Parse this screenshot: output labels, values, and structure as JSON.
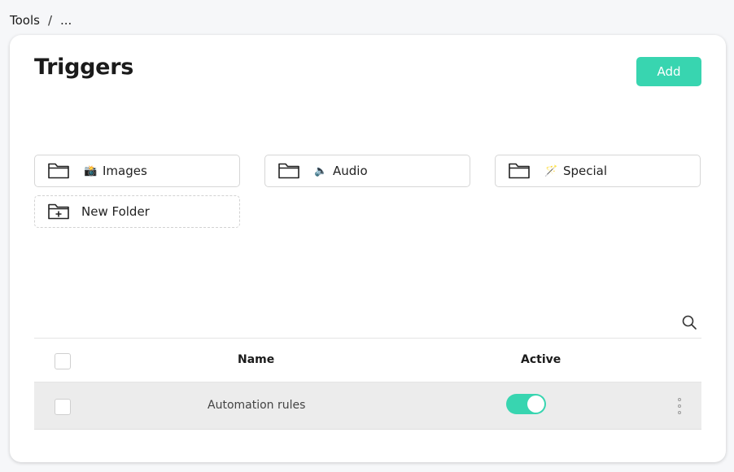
{
  "breadcrumb": {
    "items": [
      "Tools",
      "..."
    ],
    "separator": "/"
  },
  "page": {
    "title": "Triggers",
    "add_label": "Add"
  },
  "folders": [
    {
      "emoji": "📸",
      "label": "Images"
    },
    {
      "emoji": "🔈",
      "label": "Audio"
    },
    {
      "emoji": "🪄",
      "label": "Special"
    }
  ],
  "new_folder": {
    "label": "New Folder"
  },
  "table": {
    "columns": [
      "Name",
      "Active"
    ],
    "rows": [
      {
        "name": "Automation rules",
        "active": true
      }
    ]
  },
  "colors": {
    "accent": "#38d5b0",
    "row_bg": "#ececec"
  }
}
